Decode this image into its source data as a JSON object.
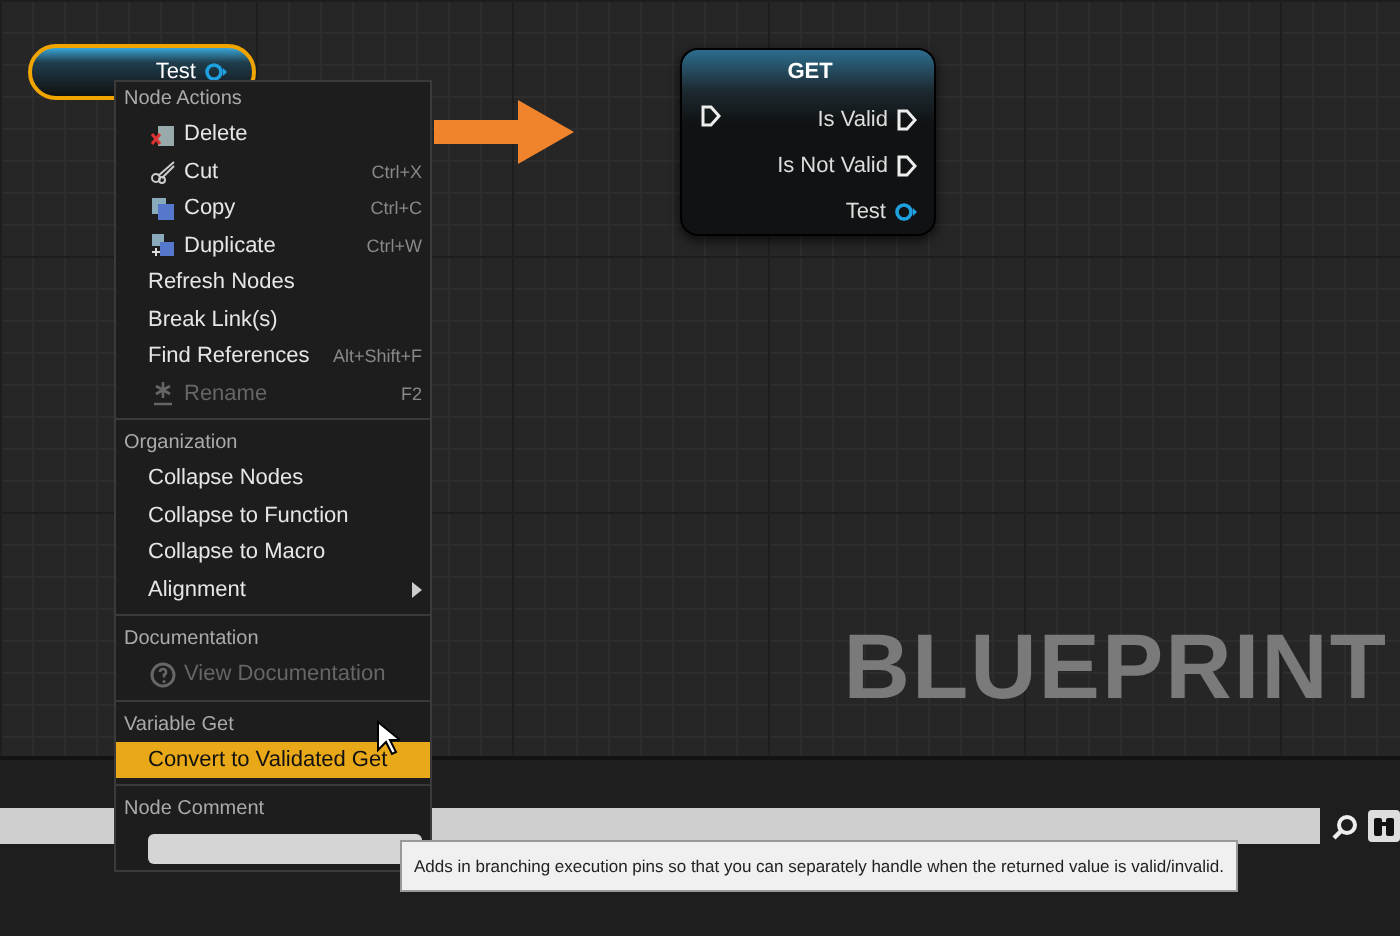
{
  "graph": {
    "watermark": "BLUEPRINT",
    "variable_node": {
      "label": "Test",
      "selected": true
    },
    "get_node": {
      "title": "GET",
      "pins": [
        {
          "label": "Is Valid",
          "kind": "exec"
        },
        {
          "label": "Is Not Valid",
          "kind": "exec"
        },
        {
          "label": "Test",
          "kind": "data"
        }
      ]
    }
  },
  "context_menu": {
    "sections": [
      {
        "title": "Node Actions",
        "items": [
          {
            "label": "Delete",
            "disabled": false,
            "selected": false
          },
          {
            "label": "Cut",
            "shortcut": "Ctrl+X",
            "disabled": false,
            "selected": false
          },
          {
            "label": "Copy",
            "shortcut": "Ctrl+C",
            "disabled": false,
            "selected": false
          },
          {
            "label": "Duplicate",
            "shortcut": "Ctrl+W",
            "disabled": false,
            "selected": false
          },
          {
            "label": "Refresh Nodes",
            "disabled": false,
            "selected": false
          },
          {
            "label": "Break Link(s)",
            "disabled": false,
            "selected": false
          },
          {
            "label": "Find References",
            "shortcut": "Alt+Shift+F",
            "disabled": false,
            "selected": false
          },
          {
            "label": "Rename",
            "shortcut": "F2",
            "disabled": true,
            "selected": false
          }
        ]
      },
      {
        "title": "Organization",
        "items": [
          {
            "label": "Collapse Nodes",
            "disabled": false,
            "selected": false
          },
          {
            "label": "Collapse to Function",
            "disabled": false,
            "selected": false
          },
          {
            "label": "Collapse to Macro",
            "disabled": false,
            "selected": false
          },
          {
            "label": "Alignment",
            "submenu": true,
            "disabled": false,
            "selected": false
          }
        ]
      },
      {
        "title": "Documentation",
        "items": [
          {
            "label": "View Documentation",
            "disabled": true,
            "selected": false
          }
        ]
      },
      {
        "title": "Variable Get",
        "items": [
          {
            "label": "Convert to Validated Get",
            "disabled": false,
            "selected": true
          }
        ]
      },
      {
        "title": "Node Comment",
        "comment_field": true
      }
    ]
  },
  "tooltip": "Adds in branching execution pins so that you can separately handle when the returned value is valid/invalid."
}
